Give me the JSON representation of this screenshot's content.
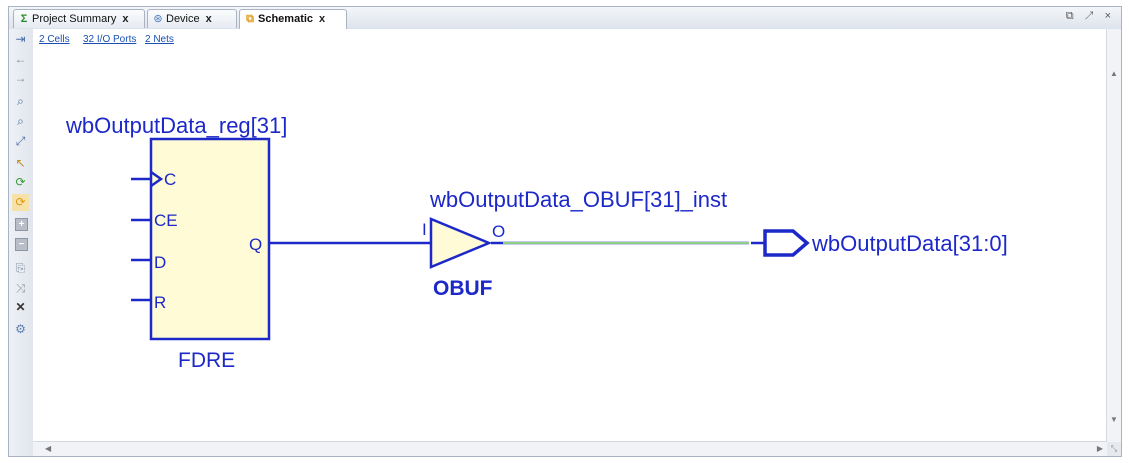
{
  "tabs": [
    {
      "label": "Project Summary",
      "icon": "sigma-icon"
    },
    {
      "label": "Device",
      "icon": "device-icon"
    },
    {
      "label": "Schematic",
      "icon": "schematic-icon",
      "active": true
    }
  ],
  "tab_close": "x",
  "window_controls": "⧉ ↗ ×",
  "info_links": {
    "cells": "2 Cells",
    "ports": "32 I/O Ports",
    "nets": "2 Nets"
  },
  "schematic": {
    "register": {
      "instance_name": "wbOutputData_reg[31]",
      "cell_type": "FDRE",
      "pins_in": [
        "C",
        "CE",
        "D",
        "R"
      ],
      "pin_out": "Q",
      "body_color": "#fffbd6"
    },
    "buffer": {
      "instance_name": "wbOutputData_OBUF[31]_inst",
      "cell_type": "OBUF",
      "pin_in": "I",
      "pin_out": "O",
      "body_color": "#fffbd6"
    },
    "output_port": {
      "name": "wbOutputData[31:0]"
    },
    "colors": {
      "symbol": "#1c28c8",
      "net": "#1c28c8",
      "net_selected": "#8ccf7e"
    }
  }
}
